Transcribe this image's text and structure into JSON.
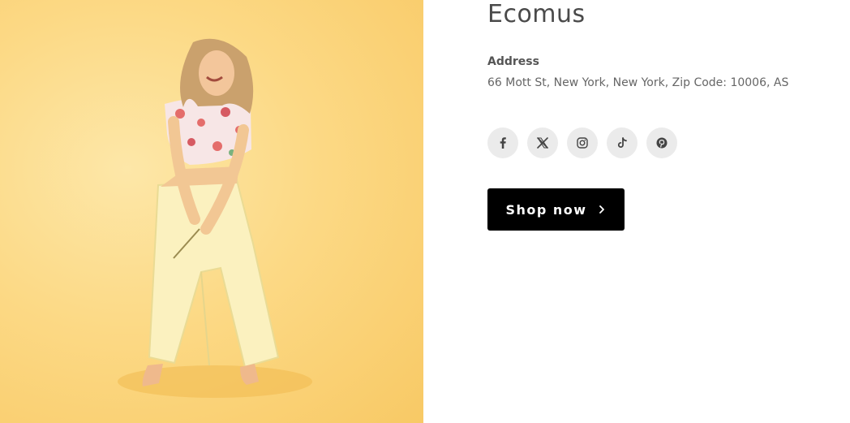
{
  "hero": {
    "image_alt": "woman in floral top and pale yellow pants on a yellow background"
  },
  "store": {
    "name": "Ecomus",
    "address_label": "Address",
    "address": "66 Mott St, New York, New York, Zip Code: 10006, AS"
  },
  "socials": [
    {
      "icon": "facebook-icon"
    },
    {
      "icon": "x-icon"
    },
    {
      "icon": "instagram-icon"
    },
    {
      "icon": "tiktok-icon"
    },
    {
      "icon": "pinterest-icon"
    }
  ],
  "cta": {
    "label": "Shop now",
    "icon": "chevron-right-icon"
  },
  "colors": {
    "hero_background": "#fcd985",
    "button_background": "#000000",
    "button_text": "#ffffff",
    "social_background": "#ebebeb"
  }
}
